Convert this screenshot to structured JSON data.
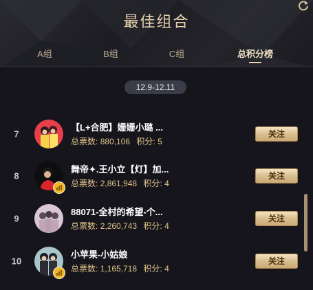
{
  "title": "最佳组合",
  "tabs": [
    {
      "label": "A组",
      "active": false
    },
    {
      "label": "B组",
      "active": false
    },
    {
      "label": "C组",
      "active": false
    },
    {
      "label": "总积分榜",
      "active": true
    }
  ],
  "date_range": "12.9-12.11",
  "colors": {
    "accent_gold": "#e8d3ad",
    "stats_gold": "#e0c28c",
    "background": "#15151b",
    "follow_button": "#d9bf8f"
  },
  "rows": [
    {
      "rank": "7",
      "name": "【L+合肥】姗姗小璐 ...",
      "votes_label": "总票数:",
      "votes": "880,106",
      "points_label": "积分:",
      "points": "5",
      "follow_label": "关注"
    },
    {
      "rank": "8",
      "name": "舞帝✦.王小立【灯】加...",
      "votes_label": "总票数:",
      "votes": "2,861,948",
      "points_label": "积分:",
      "points": "4",
      "follow_label": "关注"
    },
    {
      "rank": "9",
      "name": "88071-全村的希望-个...",
      "votes_label": "总票数:",
      "votes": "2,260,743",
      "points_label": "积分:",
      "points": "4",
      "follow_label": "关注"
    },
    {
      "rank": "10",
      "name": "小苹果-小姑娘",
      "votes_label": "总票数:",
      "votes": "1,165,718",
      "points_label": "积分:",
      "points": "4",
      "follow_label": "关注"
    }
  ]
}
